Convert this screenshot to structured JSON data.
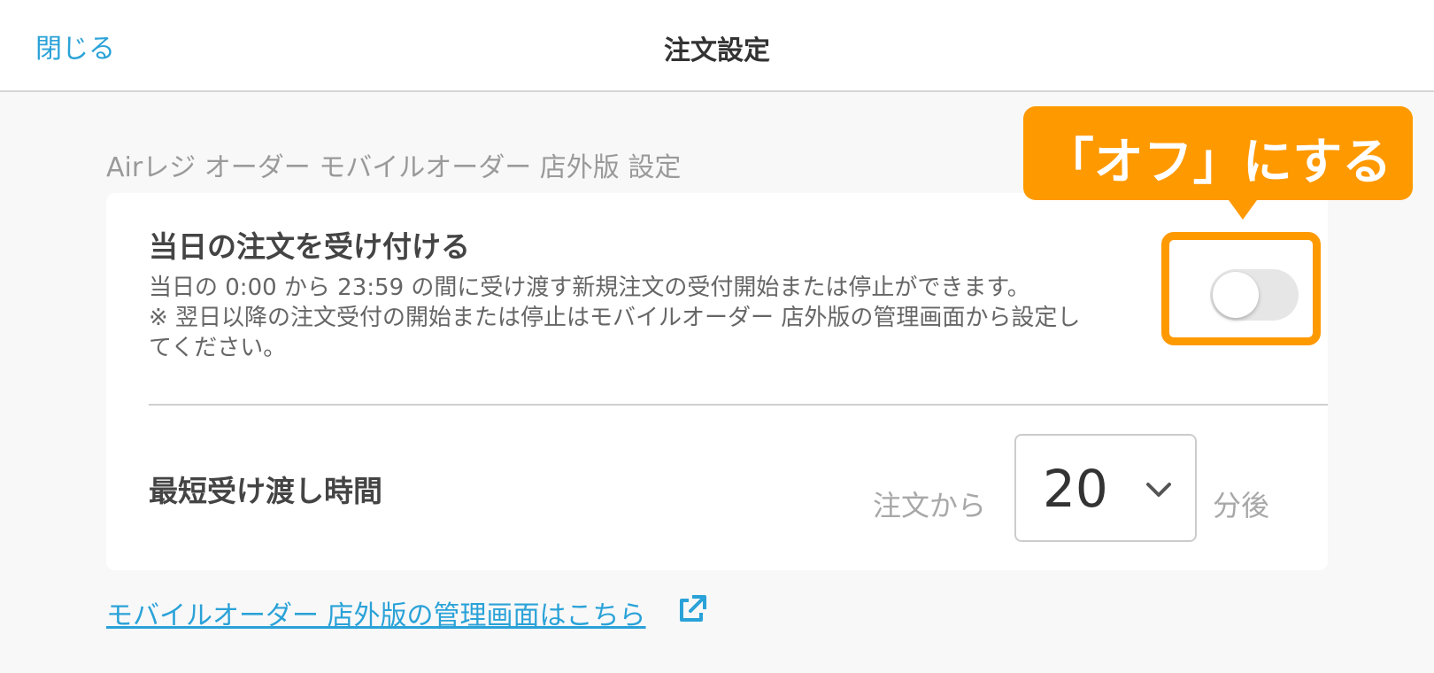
{
  "header": {
    "close_label": "閉じる",
    "title": "注文設定"
  },
  "section": {
    "title": "Airレジ オーダー モバイルオーダー 店外版 設定"
  },
  "settings": {
    "same_day_orders": {
      "title": "当日の注文を受け付ける",
      "description_line1": "当日の 0:00 から 23:59 の間に受け渡す新規注文の受付開始または停止ができます。",
      "description_line2": "※ 翌日以降の注文受付の開始または停止はモバイルオーダー 店外版の管理画面から設定し",
      "description_line3": "てください。",
      "toggle_on": false
    },
    "min_handover_time": {
      "title": "最短受け渡し時間",
      "prefix_label": "注文から",
      "selected_value": "20",
      "suffix_label": "分後"
    }
  },
  "footer_link": {
    "label": "モバイルオーダー 店外版の管理画面はこちら",
    "icon": "external-link-icon"
  },
  "callout": {
    "text": "「オフ」にする",
    "color": "#ff9900"
  },
  "colors": {
    "accent": "#2aa2d8",
    "highlight": "#ff9900"
  }
}
